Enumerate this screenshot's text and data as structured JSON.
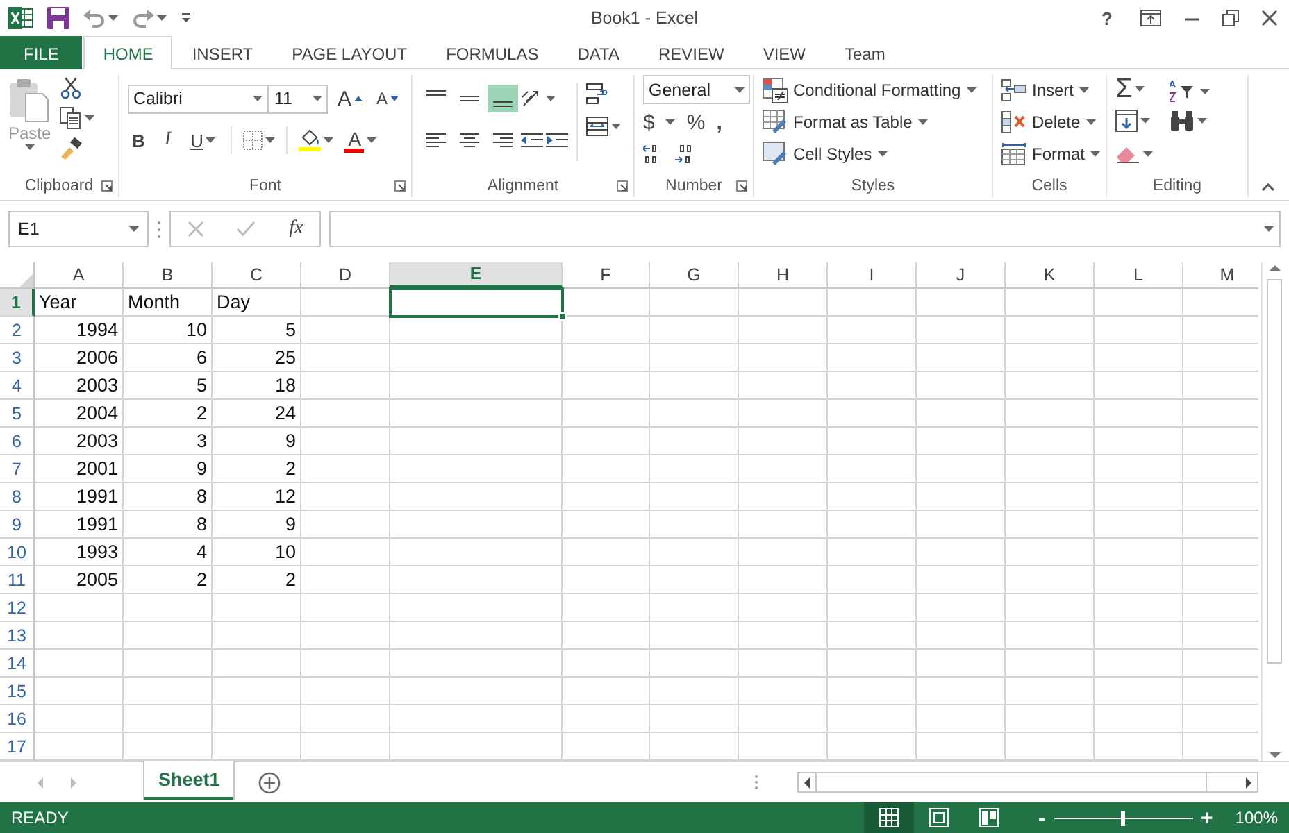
{
  "title_bar": {
    "title": "Book1 - Excel",
    "help": "?"
  },
  "ribbon_tabs": [
    {
      "label": "FILE",
      "kind": "file",
      "selected": false
    },
    {
      "label": "HOME",
      "kind": "tab",
      "selected": true
    },
    {
      "label": "INSERT",
      "kind": "tab",
      "selected": false
    },
    {
      "label": "PAGE LAYOUT",
      "kind": "tab",
      "selected": false
    },
    {
      "label": "FORMULAS",
      "kind": "tab",
      "selected": false
    },
    {
      "label": "DATA",
      "kind": "tab",
      "selected": false
    },
    {
      "label": "REVIEW",
      "kind": "tab",
      "selected": false
    },
    {
      "label": "VIEW",
      "kind": "tab",
      "selected": false
    },
    {
      "label": "Team",
      "kind": "tab",
      "selected": false
    }
  ],
  "clipboard": {
    "paste": "Paste",
    "paste_disabled": true,
    "label": "Clipboard"
  },
  "font": {
    "name": "Calibri",
    "size": "11",
    "grow": "A",
    "shrink": "A",
    "bold": "B",
    "italic": "I",
    "underline": "U",
    "color_letter": "A",
    "label": "Font"
  },
  "alignment": {
    "vertical": [
      {
        "selected": false
      },
      {
        "selected": false
      },
      {
        "selected": true
      }
    ],
    "horizontal": [
      {
        "selected": false
      },
      {
        "selected": false
      },
      {
        "selected": false
      }
    ],
    "label": "Alignment"
  },
  "number": {
    "format": "General",
    "currency": "$",
    "percent": "%",
    "comma": ",",
    "label": "Number"
  },
  "styles": {
    "items": [
      "Conditional Formatting",
      "Format as Table",
      "Cell Styles"
    ],
    "label": "Styles"
  },
  "cells": {
    "items": [
      "Insert",
      "Delete",
      "Format"
    ],
    "label": "Cells"
  },
  "editing": {
    "sum": "Σ",
    "label": "Editing"
  },
  "formula_bar": {
    "name_box": "E1",
    "fx": "fx"
  },
  "sheet": {
    "columns": [
      {
        "label": "A",
        "selected": false
      },
      {
        "label": "B",
        "selected": false
      },
      {
        "label": "C",
        "selected": false
      },
      {
        "label": "D",
        "selected": false
      },
      {
        "label": "E",
        "selected": true
      },
      {
        "label": "F",
        "selected": false
      },
      {
        "label": "G",
        "selected": false
      },
      {
        "label": "H",
        "selected": false
      },
      {
        "label": "I",
        "selected": false
      },
      {
        "label": "J",
        "selected": false
      },
      {
        "label": "K",
        "selected": false
      },
      {
        "label": "L",
        "selected": false
      },
      {
        "label": "M",
        "selected": false
      }
    ],
    "rows": [
      {
        "number": "1",
        "selected": true,
        "kind": "text",
        "cells": [
          "Year",
          "Month",
          "Day"
        ]
      },
      {
        "number": "2",
        "selected": false,
        "kind": "number",
        "cells": [
          "1994",
          "10",
          "5"
        ]
      },
      {
        "number": "3",
        "selected": false,
        "kind": "number",
        "cells": [
          "2006",
          "6",
          "25"
        ]
      },
      {
        "number": "4",
        "selected": false,
        "kind": "number",
        "cells": [
          "2003",
          "5",
          "18"
        ]
      },
      {
        "number": "5",
        "selected": false,
        "kind": "number",
        "cells": [
          "2004",
          "2",
          "24"
        ]
      },
      {
        "number": "6",
        "selected": false,
        "kind": "number",
        "cells": [
          "2003",
          "3",
          "9"
        ]
      },
      {
        "number": "7",
        "selected": false,
        "kind": "number",
        "cells": [
          "2001",
          "9",
          "2"
        ]
      },
      {
        "number": "8",
        "selected": false,
        "kind": "number",
        "cells": [
          "1991",
          "8",
          "12"
        ]
      },
      {
        "number": "9",
        "selected": false,
        "kind": "number",
        "cells": [
          "1991",
          "8",
          "9"
        ]
      },
      {
        "number": "10",
        "selected": false,
        "kind": "number",
        "cells": [
          "1993",
          "4",
          "10"
        ]
      },
      {
        "number": "11",
        "selected": false,
        "kind": "number",
        "cells": [
          "2005",
          "2",
          "2"
        ]
      },
      {
        "number": "12",
        "selected": false,
        "kind": "empty"
      },
      {
        "number": "13",
        "selected": false,
        "kind": "empty"
      },
      {
        "number": "14",
        "selected": false,
        "kind": "empty"
      },
      {
        "number": "15",
        "selected": false,
        "kind": "empty"
      },
      {
        "number": "16",
        "selected": false,
        "kind": "empty"
      },
      {
        "number": "17",
        "selected": false,
        "kind": "empty"
      }
    ]
  },
  "sheet_tabs": [
    {
      "label": "Sheet1",
      "selected": true
    }
  ],
  "status_bar": {
    "status": "READY",
    "views": [
      {
        "selected": true
      },
      {
        "selected": false
      },
      {
        "selected": false
      }
    ],
    "zoom_out": "-",
    "zoom_in": "+",
    "zoom_slider": {
      "level": 0.5
    },
    "zoom": "100%"
  }
}
